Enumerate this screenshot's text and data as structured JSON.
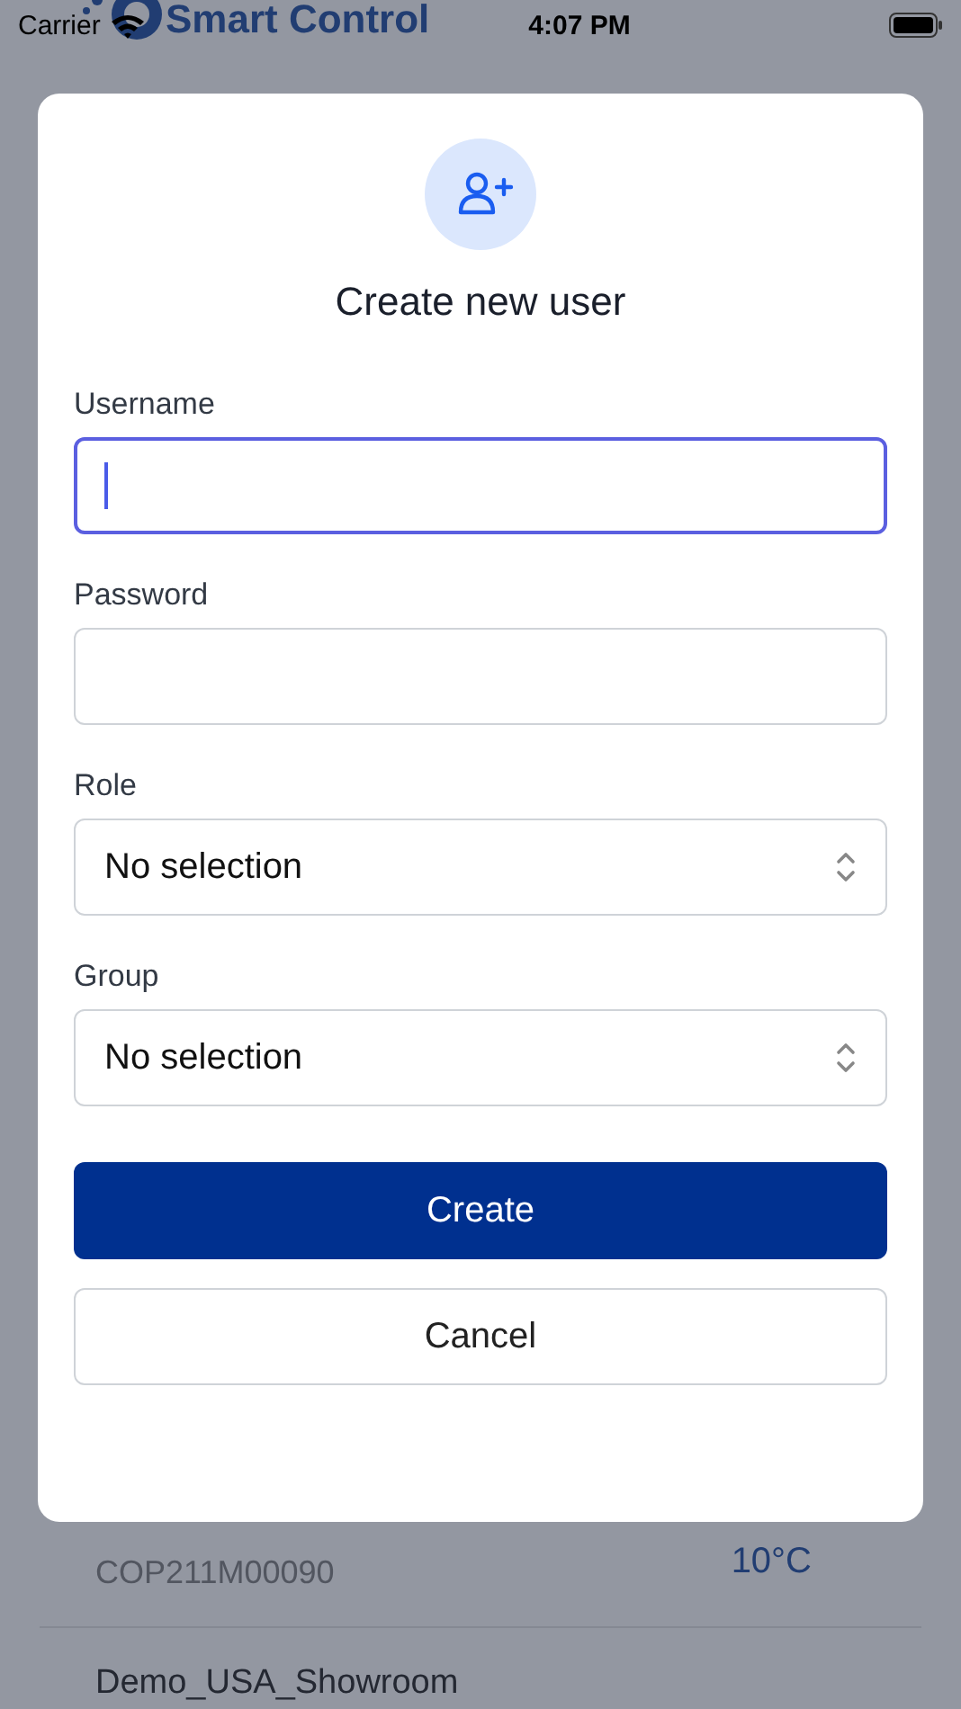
{
  "status_bar": {
    "carrier": "Carrier",
    "time": "4:07 PM"
  },
  "app_header": {
    "title": "Smart Control"
  },
  "device_list": [
    {
      "id_text": "COP211M00090",
      "temperature": "10°C"
    },
    {
      "name": "Demo_USA_Showroom"
    }
  ],
  "dialog": {
    "title": "Create new user",
    "fields": [
      {
        "kind": "text",
        "label": "Username",
        "focused": true
      },
      {
        "kind": "text",
        "label": "Password",
        "focused": false
      },
      {
        "kind": "select",
        "label": "Role",
        "value": "No selection",
        "focused": false
      },
      {
        "kind": "select",
        "label": "Group",
        "value": "No selection",
        "focused": false
      }
    ],
    "primary_button": "Create",
    "secondary_button": "Cancel"
  }
}
